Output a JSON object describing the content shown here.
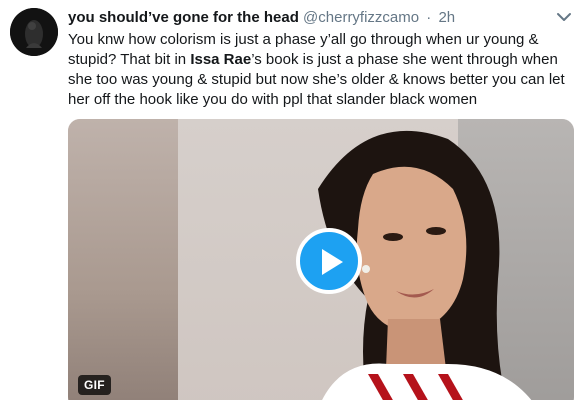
{
  "tweet": {
    "display_name": "you should’ve gone for the head",
    "handle": "@cherryfizzcamo",
    "separator": "·",
    "time": "2h",
    "text_part1": "You knw how colorism is just a phase y’all go through when ur young & stupid? That bit in ",
    "text_mention": "Issa Rae",
    "text_part2": "’s book is just a phase she went through when she too was young & stupid but now she’s older & knows better you can let her off the hook like you do with ppl that slander black women",
    "media": {
      "badge": "GIF",
      "play_icon": "play-icon"
    },
    "icons": {
      "caret": "chevron-down-icon"
    },
    "colors": {
      "accent": "#1da1f2",
      "text": "#14171a",
      "muted": "#657786"
    }
  }
}
